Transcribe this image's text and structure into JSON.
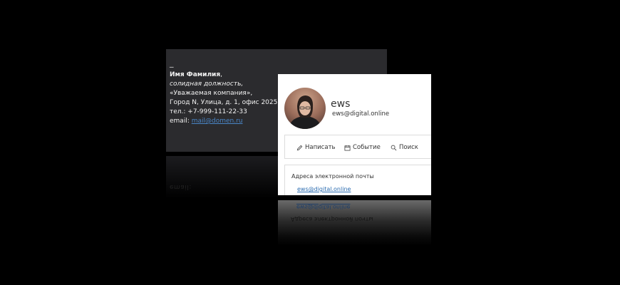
{
  "signature": {
    "dash": "_",
    "name": "Имя Фамилия",
    "name_suffix": ",",
    "position": "солидная должность,",
    "company": "«Уважаемая компания»,",
    "address": "Город N, Улица, д. 1, офис 2025",
    "phone": "тел.: +7-999-111-22-33",
    "email_label": "email: ",
    "email": "mail@domen.ru"
  },
  "contact": {
    "name": "ews",
    "email": "ews@digital.online",
    "actions": {
      "write": "Написать",
      "event": "Событие",
      "search": "Поиск"
    },
    "emails_title": "Адреса электронной почты",
    "emails": [
      "ews@digital.online"
    ]
  },
  "colors": {
    "background": "#000000",
    "signature_bg": "#2b2b2e",
    "link": "#2b6cb0"
  },
  "icons": {
    "write": "pencil-icon",
    "event": "calendar-icon",
    "search": "magnifier-icon"
  }
}
